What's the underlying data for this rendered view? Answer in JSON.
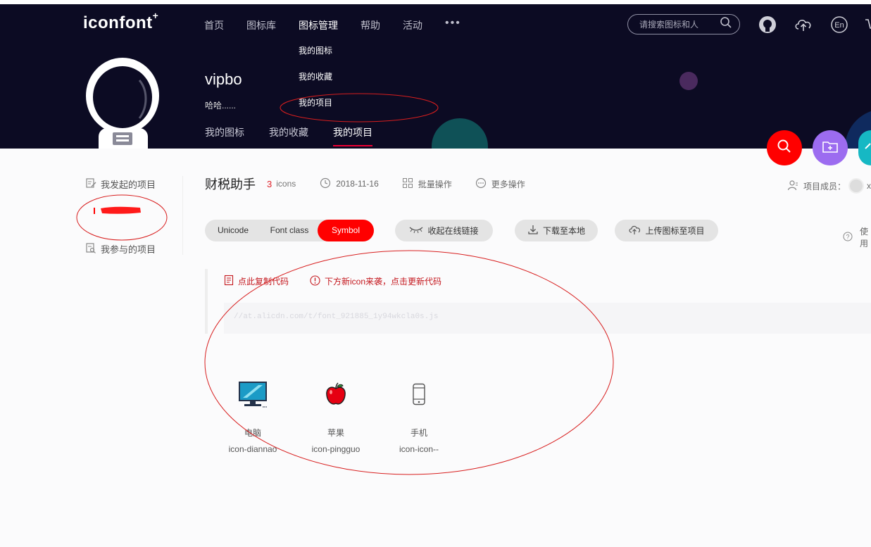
{
  "header": {
    "logo": "iconfont",
    "logo_mark": "+",
    "nav": [
      "首页",
      "图标库",
      "图标管理",
      "帮助",
      "活动"
    ],
    "nav_active": "图标管理",
    "nav_more": "•••",
    "dropdown": [
      "我的图标",
      "我的收藏",
      "我的项目"
    ],
    "search_placeholder": "请搜索图标和人",
    "icons": [
      "github-icon",
      "upload-cloud-icon",
      "language-en-icon",
      "cart-icon"
    ],
    "lang_label": "En"
  },
  "user": {
    "name": "vipbo",
    "desc": "哈哈......",
    "tabs": [
      "我的图标",
      "我的收藏",
      "我的项目"
    ],
    "active_tab": "我的项目"
  },
  "fab": [
    "search-icon",
    "new-folder-icon",
    "arrow-up-icon"
  ],
  "sidebar": {
    "items": [
      "我发起的项目",
      "我参与的项目"
    ]
  },
  "project": {
    "title": "财税助手",
    "count": "3",
    "count_unit": "icons",
    "date": "2018-11-16",
    "batch": "批量操作",
    "more": "更多操作",
    "members_label": "项目成员：",
    "members_tail": "x"
  },
  "toolbar": {
    "formats": [
      "Unicode",
      "Font class",
      "Symbol"
    ],
    "active_format": "Symbol",
    "collapse_link": "收起在线链接",
    "download": "下载至本地",
    "upload": "上传图标至项目",
    "help": "使用"
  },
  "code": {
    "copy": "点此复制代码",
    "update": "下方新icon来袭，点击更新代码",
    "url": "//at.alicdn.com/t/font_921885_1y94wkcla0s.js"
  },
  "icons": [
    {
      "name": "电脑",
      "code": "icon-diannao",
      "glyph": "computer-icon"
    },
    {
      "name": "苹果",
      "code": "icon-pingguo",
      "glyph": "apple-icon"
    },
    {
      "name": "手机",
      "code": "icon-icon--",
      "glyph": "phone-icon"
    }
  ],
  "colors": {
    "header_bg": "#0c0b23",
    "accent_red": "#ff0000",
    "fab_purple": "#9c6cf0",
    "fab_teal": "#16b8c4",
    "link_red": "#c4161c"
  }
}
